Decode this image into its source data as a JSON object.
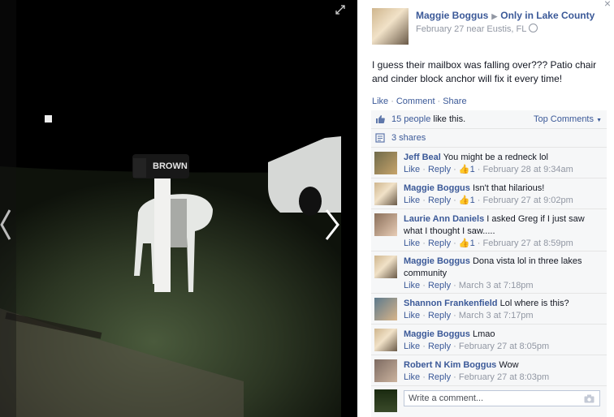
{
  "post": {
    "author": "Maggie Boggus",
    "group": "Only in Lake County",
    "date": "February 27 near Eustis, FL",
    "text": "I guess their mailbox was falling over??? Patio chair and cinder block anchor will fix it every time!",
    "actions": {
      "like": "Like",
      "comment": "Comment",
      "share": "Share"
    }
  },
  "photo": {
    "mailbox_text": "BROWN"
  },
  "summary": {
    "likes_count": "15 people",
    "likes_suffix": " like this.",
    "top_comments": "Top Comments",
    "shares": "3 shares"
  },
  "comments": [
    {
      "author": "Jeff Beal",
      "text": "You might be a redneck lol",
      "like": "Like",
      "reply": "Reply",
      "likes": "1",
      "time": "February 28 at 9:34am"
    },
    {
      "author": "Maggie Boggus",
      "text": "Isn't that hilarious!",
      "like": "Like",
      "reply": "Reply",
      "likes": "1",
      "time": "February 27 at 9:02pm"
    },
    {
      "author": "Laurie Ann Daniels",
      "text": "I asked Greg if I just saw what I thought I saw.....",
      "like": "Like",
      "reply": "Reply",
      "likes": "1",
      "time": "February 27 at 8:59pm"
    },
    {
      "author": "Maggie Boggus",
      "text": "Dona vista lol in three lakes community",
      "like": "Like",
      "reply": "Reply",
      "time": "March 3 at 7:18pm"
    },
    {
      "author": "Shannon Frankenfield",
      "text": "Lol where is this?",
      "like": "Like",
      "reply": "Reply",
      "time": "March 3 at 7:17pm"
    },
    {
      "author": "Maggie Boggus",
      "text": "Lmao",
      "like": "Like",
      "reply": "Reply",
      "time": "February 27 at 8:05pm"
    },
    {
      "author": "Robert N Kim Boggus",
      "text": "Wow",
      "like": "Like",
      "reply": "Reply",
      "time": "February 27 at 8:03pm"
    }
  ],
  "write": {
    "placeholder": "Write a comment..."
  },
  "colors": {
    "link": "#3b5998",
    "meta": "#9197a3",
    "panel": "#f6f7f8"
  }
}
